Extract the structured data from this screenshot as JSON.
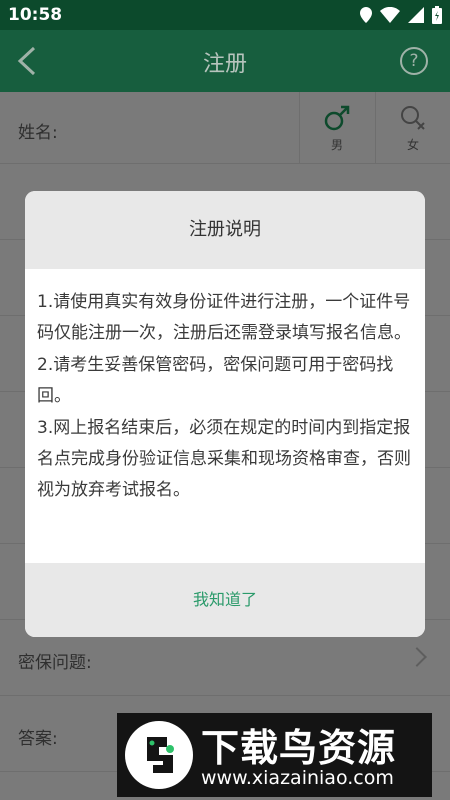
{
  "status": {
    "time": "10:58"
  },
  "appbar": {
    "title": "注册",
    "help_glyph": "?"
  },
  "form": {
    "name_label": "姓名:",
    "gender_male": "男",
    "gender_female": "女",
    "security_question_label": "密保问题:",
    "answer_label": "答案:"
  },
  "dialog": {
    "title": "注册说明",
    "lines": [
      "1.请使用真实有效身份证件进行注册，一个证件号码仅能注册一次，注册后还需登录填写报名信息。",
      "2.请考生妥善保管密码，密保问题可用于密码找回。",
      "3.网上报名结束后，必须在规定的时间内到指定报名点完成身份验证信息采集和现场资格审查，否则视为放弃考试报名。"
    ],
    "confirm_label": "我知道了"
  },
  "watermark": {
    "brand": "下载鸟资源",
    "url": "www.xiazainiao.com"
  },
  "colors": {
    "appbar": "#175e3e",
    "statusbar": "#0c4a2c",
    "accent": "#2a9a6a"
  }
}
